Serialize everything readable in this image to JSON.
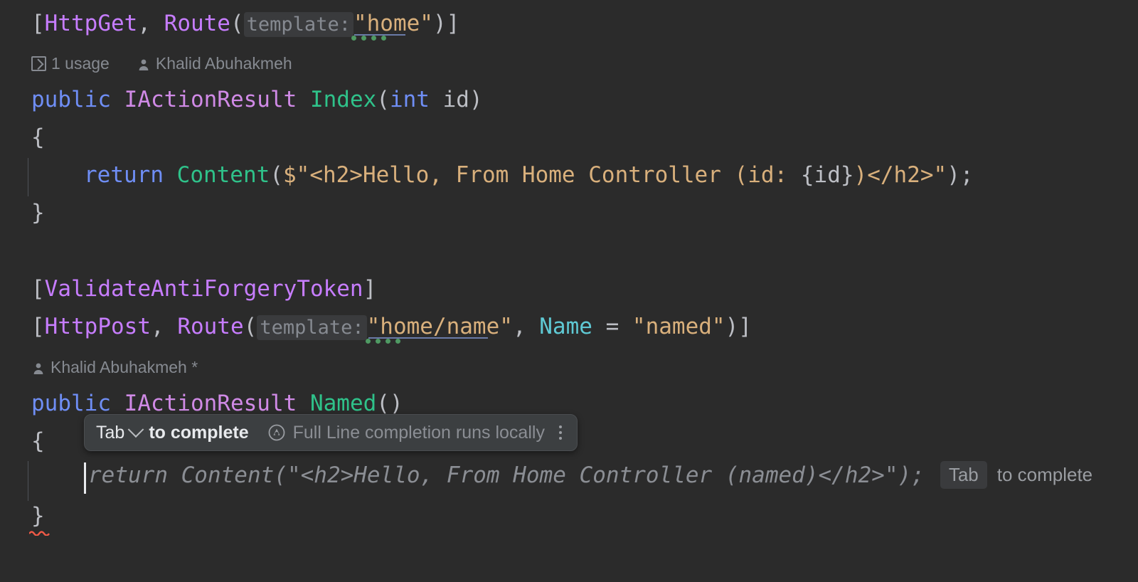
{
  "theme": {
    "background": "#2b2b2b",
    "default_text": "#bcbec4",
    "attribute": "#c77dff",
    "keyword": "#6f8ef5",
    "type": "#d08ae6",
    "method": "#2fc28a",
    "string": "#d9b07c",
    "property": "#5fc9d4",
    "inlay_hint": "#868a91",
    "ghost_text": "#8b8e94",
    "error_squiggle": "#f05a47",
    "popup_background": "#3c3f41"
  },
  "code": {
    "line1": {
      "bracket_open": "[",
      "attr_httpget": "HttpGet",
      "comma": ", ",
      "attr_route": "Route",
      "paren_open": "(",
      "param_hint": "template:",
      "string_value": "\"home\"",
      "paren_close": ")",
      "bracket_close": "]"
    },
    "codevision1": {
      "usages": "1 usage",
      "author": "Khalid Abuhakmeh"
    },
    "line2": {
      "keyword_public": "public",
      "type_iactionresult": "IActionResult",
      "method_index": "Index",
      "paren_open": "(",
      "keyword_int": "int",
      "param_id": " id",
      "paren_close": ")"
    },
    "line3": "{",
    "line4": {
      "keyword_return": "return",
      "method_content": "Content",
      "paren_open": "(",
      "interp_prefix": "$\"",
      "string_part1": "<h2>Hello, From Home Controller (id: ",
      "interp_expr": "{id}",
      "string_part2": ")</h2>\"",
      "paren_close": ")",
      "semicolon": ";"
    },
    "line5": "}",
    "line6": {
      "bracket_open": "[",
      "attr_validate": "ValidateAntiForgeryToken",
      "bracket_close": "]"
    },
    "line7": {
      "bracket_open": "[",
      "attr_httppost": "HttpPost",
      "comma": ", ",
      "attr_route": "Route",
      "paren_open": "(",
      "param_hint": "template:",
      "string_value": "\"home/name\"",
      "comma2": ", ",
      "prop_name": "Name",
      "equals": " = ",
      "named_value": "\"named\"",
      "paren_close": ")",
      "bracket_close": "]"
    },
    "codevision2": {
      "author": "Khalid Abuhakmeh *"
    },
    "line8": {
      "keyword_public": "public",
      "type_iactionresult": "IActionResult",
      "method_named": "Named",
      "parens": "()"
    },
    "line9": "{",
    "ghost_line": "return Content(\"<h2>Hello, From Home Controller (named)</h2>\");",
    "line10": "}"
  },
  "hint_popup": {
    "key_label": "Tab",
    "action_label": "to complete",
    "ai_note": "Full Line completion runs locally",
    "menu": "more-options"
  },
  "ghost_tail": {
    "key_label": "Tab",
    "action_label": "to complete"
  }
}
